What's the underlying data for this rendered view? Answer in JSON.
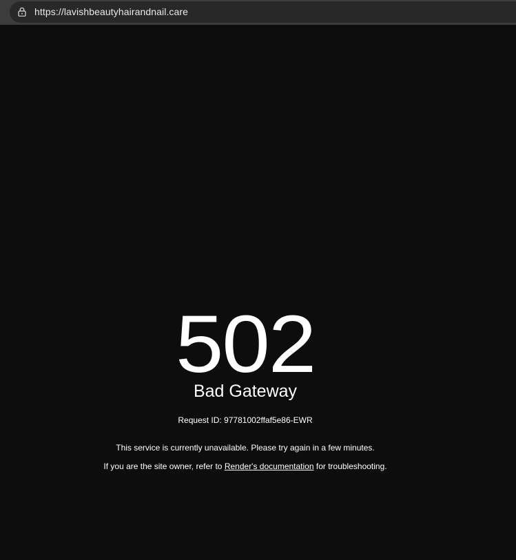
{
  "browser": {
    "url": "https://lavishbeautyhairandnail.care"
  },
  "error": {
    "code": "502",
    "reason": "Bad Gateway",
    "request_id_label": "Request ID: 97781002ffaf5e86-EWR",
    "message": "This service is currently unavailable. Please try again in a few minutes.",
    "owner_prefix": "If you are the site owner, refer to ",
    "docs_link": "Render's documentation",
    "owner_suffix": " for troubleshooting."
  },
  "colors": {
    "background": "#0d0d0d",
    "toolbar": "#3c3c3c",
    "omnibox": "#282828",
    "text": "#ffffff"
  }
}
